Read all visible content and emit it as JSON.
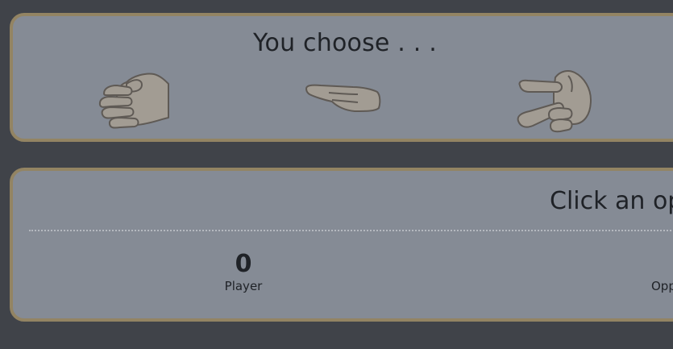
{
  "choose_panel": {
    "title": "You choose . . .",
    "options": [
      {
        "icon": "rock-hand-icon"
      },
      {
        "icon": "paper-hand-icon"
      },
      {
        "icon": "scissors-hand-icon"
      }
    ]
  },
  "result_panel": {
    "title": "Click an op",
    "player": {
      "score": "0",
      "label": "Player"
    },
    "opponent": {
      "label": "Opp"
    }
  },
  "colors": {
    "background": "#404349",
    "panel": "#858b95",
    "panel_border": "#938463",
    "hand_fill": "#a29c93",
    "hand_stroke": "#5f5a55",
    "text": "#1f2227"
  }
}
